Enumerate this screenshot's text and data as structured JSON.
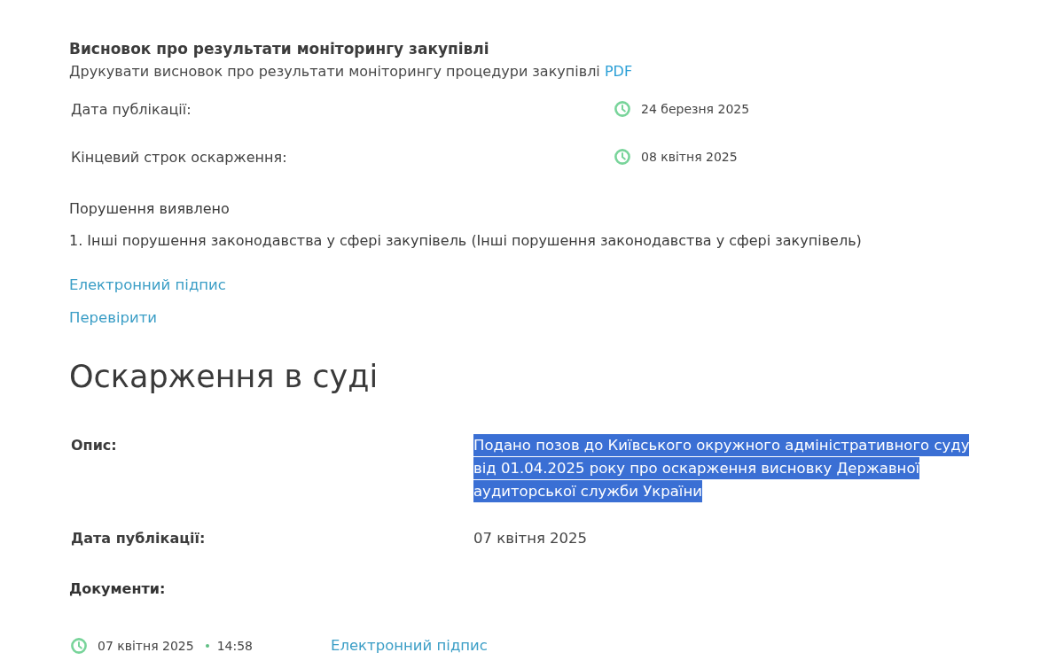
{
  "conclusion": {
    "title": "Висновок про результати моніторингу закупівлі",
    "print_text": "Друкувати висновок про результати моніторингу процедури закупівлі",
    "print_link": "PDF",
    "dates": [
      {
        "label": "Дата публікації:",
        "value": "24 березня 2025"
      },
      {
        "label": "Кінцевий строк оскарження:",
        "value": "08 квітня 2025"
      }
    ],
    "violations": {
      "heading": "Порушення виявлено",
      "items": [
        "1. Інші порушення законодавства у сфері закупівель (Інші порушення законодавства у сфері закупівель)"
      ]
    },
    "links": [
      "Електронний підпис",
      "Перевірити"
    ]
  },
  "court_appeal": {
    "title": "Оскарження в суді",
    "fields": [
      {
        "label": "Опис:",
        "value": "Подано позов до Київського окружного адміністративного суду від 01.04.2025 року про оскарження висновку Державної аудиторської служби України",
        "highlighted": true
      },
      {
        "label": "Дата публікації:",
        "value": "07 квітня 2025",
        "highlighted": false
      }
    ],
    "documents": {
      "label": "Документи:",
      "items": [
        {
          "date": "07 квітня 2025",
          "time": "14:58",
          "link": "Електронний підпис"
        }
      ]
    }
  }
}
